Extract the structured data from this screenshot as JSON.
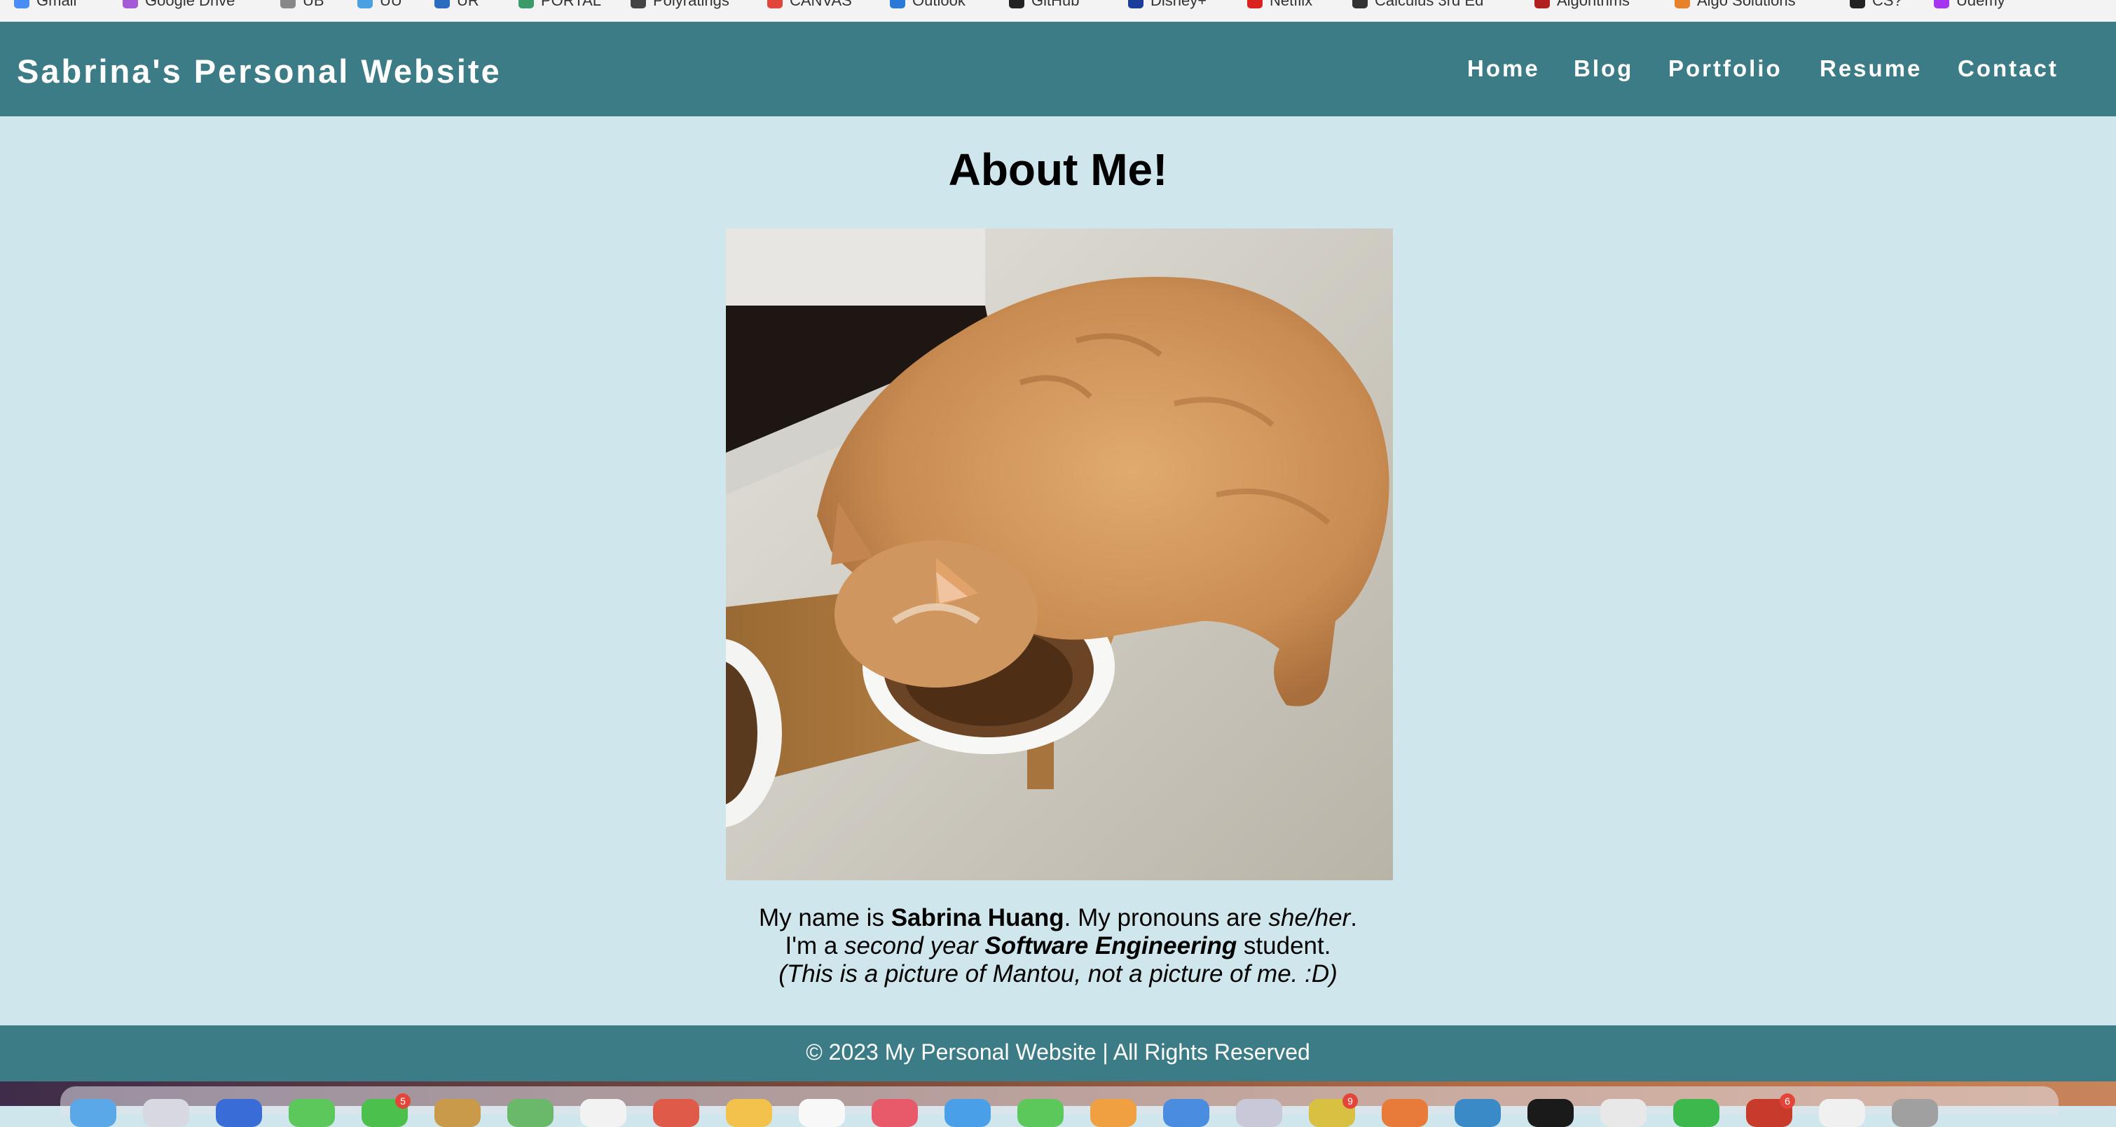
{
  "bookmarks": [
    {
      "label": "Gmail",
      "icon": "gmail-icon",
      "color": "#4a8cf5"
    },
    {
      "label": "Google Drive",
      "icon": "google-drive-icon",
      "color": "#a45ad6"
    },
    {
      "label": "UB",
      "icon": "shield-icon",
      "color": "#888888"
    },
    {
      "label": "UU",
      "icon": "folder-icon",
      "color": "#4aa0e0"
    },
    {
      "label": "UR",
      "icon": "link-icon",
      "color": "#2a6cc0"
    },
    {
      "label": "PORTAL",
      "icon": "shield-icon",
      "color": "#3c9a6a"
    },
    {
      "label": "Polyratings",
      "icon": "star-icon",
      "color": "#444444"
    },
    {
      "label": "CANVAS",
      "icon": "canvas-icon",
      "color": "#e0463a"
    },
    {
      "label": "Outlook",
      "icon": "outlook-icon",
      "color": "#2a78d8"
    },
    {
      "label": "GitHub",
      "icon": "github-icon",
      "color": "#222222"
    },
    {
      "label": "Disney+",
      "icon": "disney-icon",
      "color": "#1a3c9a"
    },
    {
      "label": "Netflix",
      "icon": "netflix-icon",
      "color": "#d8231f"
    },
    {
      "label": "Calculus 3rd Ed",
      "icon": "book-icon",
      "color": "#333333"
    },
    {
      "label": "Algorithms",
      "icon": "algorithms-icon",
      "color": "#b02020"
    },
    {
      "label": "Algo Solutions",
      "icon": "solutions-icon",
      "color": "#e8822a"
    },
    {
      "label": "CS?",
      "icon": "circle-icon",
      "color": "#222222"
    },
    {
      "label": "Udemy",
      "icon": "udemy-icon",
      "color": "#a435f0"
    }
  ],
  "header": {
    "site_title": "Sabrina's Personal Website",
    "nav": [
      {
        "label": "Home"
      },
      {
        "label": "Blog"
      },
      {
        "label": "Portfolio"
      },
      {
        "label": "Resume"
      },
      {
        "label": "Contact"
      }
    ],
    "bg_color": "#3b7c87"
  },
  "main": {
    "title": "About Me!",
    "photo_alt": "picture of Mantou",
    "bio": {
      "line1_pre": "My name is ",
      "name": "Sabrina Huang",
      "line1_mid": ". My pronouns are ",
      "pronouns": "she/her",
      "line1_end": ".",
      "line2_pre": "I'm a ",
      "year": "second year",
      "space": " ",
      "major": "Software Engineering",
      "line2_end": " student.",
      "line3_italic": "(This is a picture of Mantou, not a picture of me.",
      "line3_end": " :D)"
    },
    "bg_color": "#cfe7ec"
  },
  "footer": {
    "text": "© 2023 My Personal Website | All Rights Reserved"
  },
  "dock": {
    "badges": [
      "5",
      "9",
      "6"
    ]
  }
}
